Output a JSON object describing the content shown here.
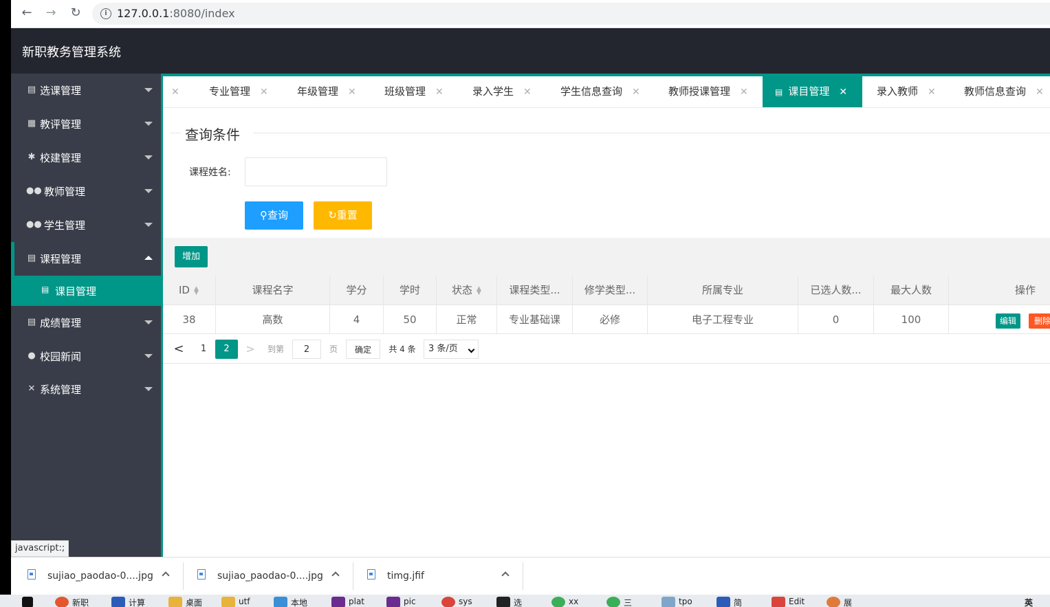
{
  "browser": {
    "url_host": "127.0.0.1",
    "url_rest": ":8080/index",
    "back_icon": "arrow-left-icon",
    "forward_icon": "arrow-right-icon",
    "reload_icon": "reload-icon"
  },
  "app": {
    "title": "新职教务管理系统"
  },
  "sidebar": {
    "items": [
      {
        "label": "选课管理",
        "icon": "document-icon"
      },
      {
        "label": "教评管理",
        "icon": "grid-icon"
      },
      {
        "label": "校建管理",
        "icon": "tree-icon"
      },
      {
        "label": "教师管理",
        "icon": "users-icon"
      },
      {
        "label": "学生管理",
        "icon": "users-icon"
      },
      {
        "label": "课程管理",
        "icon": "book-icon"
      },
      {
        "label": "成绩管理",
        "icon": "clipboard-icon"
      },
      {
        "label": "校园新闻",
        "icon": "chat-icon"
      },
      {
        "label": "系统管理",
        "icon": "tools-icon"
      }
    ],
    "child": {
      "label": "课目管理",
      "icon": "document-icon"
    }
  },
  "tabs": [
    {
      "label": "专业管理"
    },
    {
      "label": "年级管理"
    },
    {
      "label": "班级管理"
    },
    {
      "label": "录入学生"
    },
    {
      "label": "学生信息查询"
    },
    {
      "label": "教师授课管理"
    },
    {
      "label": "课目管理"
    },
    {
      "label": "录入教师"
    },
    {
      "label": "教师信息查询"
    }
  ],
  "query": {
    "legend": "查询条件",
    "field_label": "课程姓名:",
    "field_value": "",
    "search_label": "查询",
    "reset_label": "重置"
  },
  "table": {
    "add_label": "增加",
    "headers": [
      "ID",
      "课程名字",
      "学分",
      "学时",
      "状态",
      "课程类型...",
      "修学类型...",
      "所属专业",
      "已选人数...",
      "最大人数",
      "操作"
    ],
    "rows": [
      [
        "38",
        "高数",
        "4",
        "50",
        "正常",
        "专业基础课",
        "必修",
        "电子工程专业",
        "0",
        "100"
      ]
    ],
    "edit_label": "编辑",
    "delete_label": "删除"
  },
  "pager": {
    "prev": "<",
    "page1": "1",
    "page2": "2",
    "next": ">",
    "goto_label": "到第",
    "goto_value": "2",
    "page_unit": "页",
    "confirm": "确定",
    "total": "共 4 条",
    "page_size": "3 条/页"
  },
  "status_tooltip": "javascript:;",
  "downloads": [
    {
      "name": "sujiao_paodao-0....jpg"
    },
    {
      "name": "sujiao_paodao-0....jpg"
    },
    {
      "name": "timg.jfif"
    }
  ],
  "taskbar": [
    "新职",
    "计算",
    "桌面",
    "utf",
    "本地",
    "plat",
    "pic",
    "sys",
    "选",
    "xx",
    "三",
    "tpo",
    "简",
    "Edit",
    "展",
    "英"
  ],
  "colors": {
    "accent": "#009688",
    "search": "#1e9fff",
    "reset": "#ffb800",
    "delete": "#ff5722",
    "header_bg": "#23262e",
    "sidebar_bg": "#393d49"
  }
}
